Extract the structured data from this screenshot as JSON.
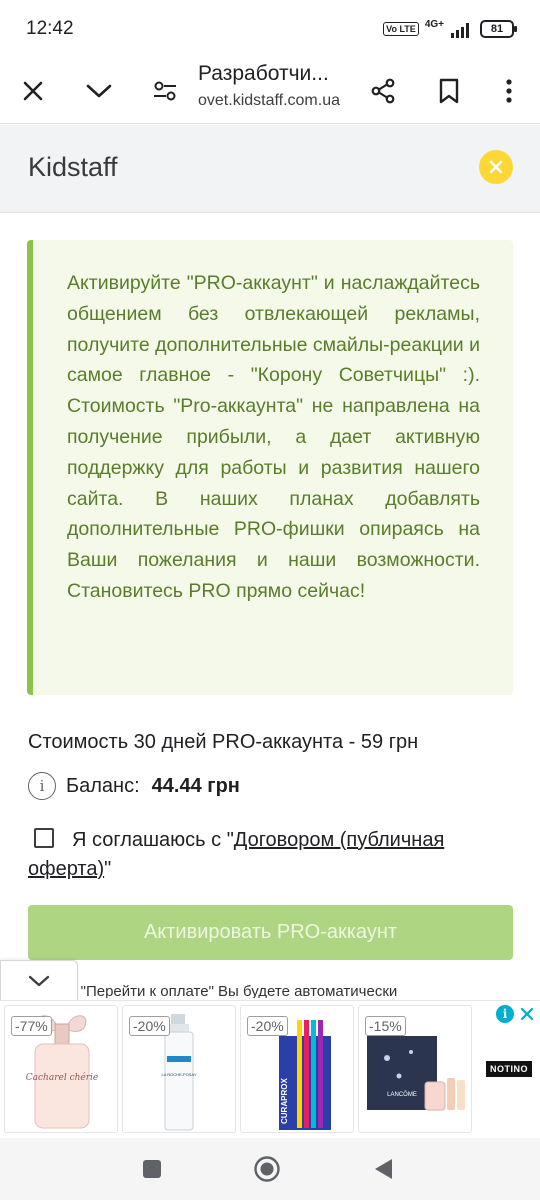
{
  "status_bar": {
    "time": "12:42",
    "volte_label": "Vo LTE",
    "network_label": "4G+",
    "battery_level": "81"
  },
  "browser": {
    "page_title": "Разработчи...",
    "url": "ovet.kidstaff.com.ua",
    "icons": [
      "close-icon",
      "chevron-down-icon",
      "tune-icon",
      "share-icon",
      "bookmark-icon",
      "more-icon"
    ]
  },
  "header": {
    "site_name": "Kidstaff"
  },
  "info_box": {
    "text": "Активируйте \"PRO-аккаунт\" и наслаждайтесь общением без отвлекающей рекламы, получите дополнительные смайлы-реакции и самое главное - \"Корону Советчицы\" :). Стоимость \"Pro-аккаунта\" не направлена на получение прибыли, а дает активную поддержку для работы и развития нашего сайта. В наших планах добавлять дополнительные PRO-фишки опираясь на Ваши пожелания и наши возможности. Становитесь PRO прямо сейчас!"
  },
  "pricing": {
    "price_text": "Стоимость 30 дней PRO-аккаунта - 59 грн",
    "balance_label": "Баланс:",
    "balance_value": "44.44 грн"
  },
  "agreement": {
    "prefix": "Я соглашаюсь с \"",
    "link": "Договором (публичная оферта)",
    "suffix": "\""
  },
  "activate_button": "Активировать PRO-аккаунт",
  "hint_partial": "ая \"Перейти к оплате\" Вы будете автоматически",
  "ads": {
    "discounts": [
      "-77%",
      "-20%",
      "-20%",
      "-15%"
    ],
    "product_labels": [
      "Cacharel chérie",
      "LA ROCHE-POSAY",
      "CURAPROX",
      "LANCÔME"
    ],
    "brand": "NOTINO",
    "adchoice_label": "i"
  },
  "colors": {
    "accent_green": "#8bc34a",
    "button_green": "#aed581",
    "close_yellow": "#fdd835"
  }
}
